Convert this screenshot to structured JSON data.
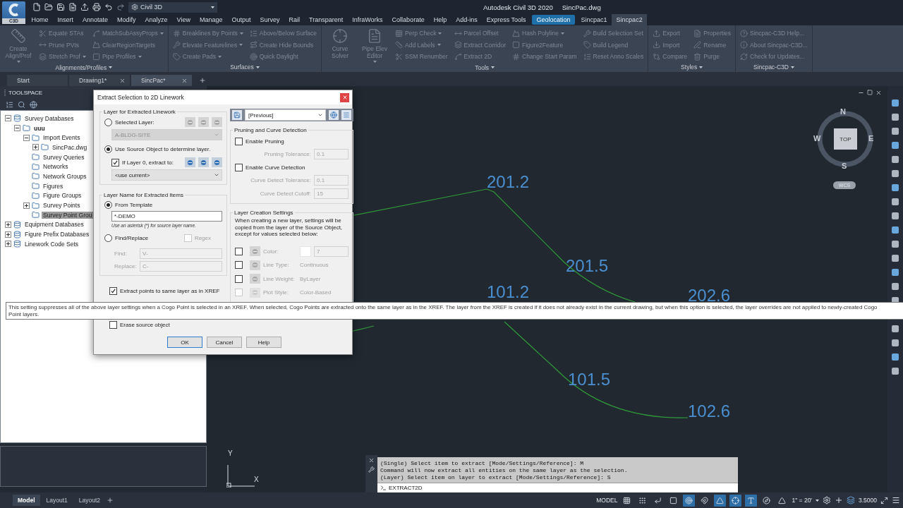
{
  "title_bar": {
    "app_badge": "C3D",
    "workspace": "Civil 3D",
    "title": "Autodesk Civil 3D 2020",
    "file": "SincPac.dwg"
  },
  "ribbon_tabs": [
    {
      "label": "Home",
      "kind": "normal",
      "selected": false
    },
    {
      "label": "Insert",
      "kind": "normal",
      "selected": false
    },
    {
      "label": "Annotate",
      "kind": "normal",
      "selected": false
    },
    {
      "label": "Modify",
      "kind": "normal",
      "selected": false
    },
    {
      "label": "Analyze",
      "kind": "normal",
      "selected": false
    },
    {
      "label": "View",
      "kind": "normal",
      "selected": false
    },
    {
      "label": "Manage",
      "kind": "normal",
      "selected": false
    },
    {
      "label": "Output",
      "kind": "normal",
      "selected": false
    },
    {
      "label": "Survey",
      "kind": "normal",
      "selected": false
    },
    {
      "label": "Rail",
      "kind": "normal",
      "selected": false
    },
    {
      "label": "Transparent",
      "kind": "normal",
      "selected": false
    },
    {
      "label": "InfraWorks",
      "kind": "normal",
      "selected": false
    },
    {
      "label": "Collaborate",
      "kind": "normal",
      "selected": false
    },
    {
      "label": "Help",
      "kind": "normal",
      "selected": false
    },
    {
      "label": "Add-ins",
      "kind": "normal",
      "selected": false
    },
    {
      "label": "Express Tools",
      "kind": "normal",
      "selected": false
    },
    {
      "label": "Geolocation",
      "kind": "contextual",
      "selected": false
    },
    {
      "label": "Sincpac1",
      "kind": "normal",
      "selected": false
    },
    {
      "label": "Sincpac2",
      "kind": "normal",
      "selected": true
    }
  ],
  "ribbon_panels": [
    {
      "title": "Alignments/Profiles",
      "columns": [
        [
          {
            "label": "Create Align/Prof",
            "kind": "large",
            "menu": true
          }
        ],
        [
          {
            "label": "Equate STAs",
            "kind": "small",
            "menu": false
          },
          {
            "label": "Prune PVIs",
            "kind": "small",
            "menu": false
          },
          {
            "label": "Stretch Prof",
            "kind": "small",
            "menu": true
          }
        ],
        [
          {
            "label": "MatchSubAssyProps",
            "kind": "small",
            "menu": true
          },
          {
            "label": "ClearRegionTargets",
            "kind": "small",
            "menu": false
          },
          {
            "label": "Pipe Profiles",
            "kind": "small",
            "menu": true
          }
        ]
      ]
    },
    {
      "title": "Surfaces",
      "columns": [
        [
          {
            "label": "Breaklines By Points",
            "kind": "small",
            "menu": true
          },
          {
            "label": "Elevate Featurelines",
            "kind": "small",
            "menu": true
          },
          {
            "label": "Create Pads",
            "kind": "small",
            "menu": true
          }
        ],
        [
          {
            "label": "Above/Below Surface",
            "kind": "small",
            "menu": false
          },
          {
            "label": "Create Hide Bounds",
            "kind": "small",
            "menu": false
          },
          {
            "label": "Quick Daylight",
            "kind": "small",
            "menu": false
          }
        ]
      ]
    },
    {
      "title": "Tools",
      "columns": [
        [
          {
            "label": "Curve Solver",
            "kind": "large",
            "menu": false
          }
        ],
        [
          {
            "label": "Pipe Elev Editor",
            "kind": "large",
            "menu": true
          }
        ],
        [
          {
            "label": "Perp Check",
            "kind": "small",
            "menu": true
          },
          {
            "label": "Add Labels",
            "kind": "small",
            "menu": true
          },
          {
            "label": "SSM Renumber",
            "kind": "small",
            "menu": false
          }
        ],
        [
          {
            "label": "Parcel Offset",
            "kind": "small",
            "menu": false
          },
          {
            "label": "Extract Corridor",
            "kind": "small",
            "menu": false
          },
          {
            "label": "Extract 2D",
            "kind": "small",
            "menu": false
          }
        ],
        [
          {
            "label": "Hash Polyline",
            "kind": "small",
            "menu": true
          },
          {
            "label": "Figure2Feature",
            "kind": "small",
            "menu": false
          },
          {
            "label": "Change Start Param",
            "kind": "small",
            "menu": false
          }
        ],
        [
          {
            "label": "Build Selection Set",
            "kind": "small",
            "menu": false
          },
          {
            "label": "Build Legend",
            "kind": "small",
            "menu": false
          },
          {
            "label": "Reset Anno Scales",
            "kind": "small",
            "menu": false
          }
        ]
      ]
    },
    {
      "title": "Styles",
      "columns": [
        [
          {
            "label": "Export",
            "kind": "small",
            "menu": false
          },
          {
            "label": "Import",
            "kind": "small",
            "menu": false
          },
          {
            "label": "Compare",
            "kind": "small",
            "menu": false
          }
        ],
        [
          {
            "label": "Properties",
            "kind": "small",
            "menu": false
          },
          {
            "label": "Rename",
            "kind": "small",
            "menu": false
          },
          {
            "label": "Purge",
            "kind": "small",
            "menu": false
          }
        ]
      ]
    },
    {
      "title": "Sincpac-C3D",
      "columns": [
        [
          {
            "label": "Sincpac-C3D Help...",
            "kind": "small",
            "menu": false
          },
          {
            "label": "About Sincpac-C3D...",
            "kind": "small",
            "menu": false
          },
          {
            "label": "Check for Updates...",
            "kind": "small",
            "menu": false
          }
        ]
      ]
    }
  ],
  "doc_tabs": [
    {
      "label": "Start",
      "closable": false,
      "selected": false
    },
    {
      "label": "Drawing1*",
      "closable": true,
      "selected": false
    },
    {
      "label": "SincPac*",
      "closable": true,
      "selected": true
    }
  ],
  "toolspace": {
    "title": "TOOLSPACE",
    "tree": [
      {
        "label": "Survey Databases",
        "expanded": true,
        "selected": false,
        "children": [
          {
            "label": "uuu",
            "expanded": true,
            "selected": false,
            "children": [
              {
                "label": "Import Events",
                "expanded": true,
                "selected": false,
                "children": [
                  {
                    "label": "SincPac.dwg",
                    "expanded": false,
                    "selected": false
                  }
                ]
              },
              {
                "label": "Survey Queries",
                "selected": false
              },
              {
                "label": "Networks",
                "selected": false
              },
              {
                "label": "Network Groups",
                "selected": false
              },
              {
                "label": "Figures",
                "selected": false
              },
              {
                "label": "Figure Groups",
                "selected": false
              },
              {
                "label": "Survey Points",
                "expanded": false,
                "selected": false
              },
              {
                "label": "Survey Point Grou",
                "selected": true
              }
            ]
          }
        ]
      },
      {
        "label": "Equipment Databases",
        "expanded": false,
        "selected": false
      },
      {
        "label": "Figure Prefix Databases",
        "expanded": false,
        "selected": false
      },
      {
        "label": "Linework Code Sets",
        "expanded": false,
        "selected": false
      }
    ]
  },
  "dialog": {
    "title": "Extract Selection to 2D Linework",
    "layer_group": {
      "title": "Layer for Extracted Linework",
      "options": [
        {
          "label": "Selected Layer:",
          "selected": false
        },
        {
          "label": "Use Source Object to determine layer.",
          "selected": true
        }
      ],
      "layer_dropdown": {
        "value": "A-BLDG-SITE",
        "disabled": true
      },
      "layer0_checkbox": {
        "label": "If Layer 0, extract to:",
        "checked": true
      },
      "layer0_dropdown": {
        "value": "<use current>"
      }
    },
    "name_group": {
      "title": "Layer Name for Extracted Items",
      "options": [
        {
          "label": "From Template",
          "selected": true
        },
        {
          "label": "Find/Replace",
          "selected": false
        }
      ],
      "template": {
        "value": "*-DEMO"
      },
      "hint": "Use an asterisk (*) for source layer name.",
      "regex": {
        "label": "Regex",
        "checked": false,
        "disabled": true
      },
      "find": {
        "label": "Find:",
        "value": "V-"
      },
      "replace": {
        "label": "Replace:",
        "value": "C-"
      }
    },
    "options": [
      {
        "label": "Extract points to same layer as in XREF",
        "checked": true
      },
      {
        "label": "Erase source object",
        "checked": false
      }
    ],
    "preset": {
      "value": "[Previous]"
    },
    "pruning_group": {
      "title": "Pruning and Curve Detection",
      "rows": [
        {
          "kind": "checkbox",
          "label": "Enable Pruning",
          "checked": false
        },
        {
          "kind": "field",
          "label": "Pruning Tolerance:",
          "value": "0.1"
        },
        {
          "kind": "checkbox",
          "label": "Enable Curve Detection",
          "checked": false
        },
        {
          "kind": "field",
          "label": "Curve Detect Tolerance:",
          "value": "0.1"
        },
        {
          "kind": "field",
          "label": "Curve Detect Cutoff:",
          "value": "15"
        }
      ]
    },
    "creation_group": {
      "title": "Layer Creation Settings",
      "description": "When creating a new layer, settings will be copied from the layer of the Source Object, except for values selected below:",
      "rows": [
        {
          "kind": "color",
          "label": "Color:",
          "value": "7",
          "checked": false,
          "disabled": false
        },
        {
          "kind": "text",
          "label": "Line Type:",
          "value": "Continuous",
          "checked": false,
          "disabled": false
        },
        {
          "kind": "text",
          "label": "Line Weight:",
          "value": "ByLayer",
          "checked": false,
          "disabled": false
        },
        {
          "kind": "text",
          "label": "Plot Style:",
          "value": "Color-Based",
          "checked": false,
          "disabled": true
        }
      ]
    },
    "buttons": [
      {
        "label": "OK",
        "default": true
      },
      {
        "label": "Cancel",
        "default": false
      },
      {
        "label": "Help",
        "default": false
      }
    ]
  },
  "tooltip": {
    "lines": [
      "This setting suppresses all of the above layer settings when a Cogo Point is selected in an XREF.  When selected, Cogo Points are extracted onto the same layer as in the XREF.  The layer from the XREF is created if it does not already exist in the current drawing, but when this option is selected, the layer overrides are not applied to newly-created Cogo",
      "Point layers."
    ]
  },
  "canvas_labels": [
    {
      "text": "201.2"
    },
    {
      "text": "201.5"
    },
    {
      "text": "101.2"
    },
    {
      "text": "202.6"
    },
    {
      "text": "101.5"
    },
    {
      "text": "102.6"
    }
  ],
  "viewcube": {
    "north": "N",
    "south": "S",
    "east": "E",
    "west": "W",
    "face": "TOP",
    "ucs": "WCS"
  },
  "ucs_icon": {
    "y": "Y",
    "x": "X"
  },
  "command_line": {
    "history": [
      "(Single) Select item to extract [Mode/Settings/Reference]: M",
      "Command will now extract all entities on the same layer as the selection.",
      "(Layer) Select item on layer to extract [Mode/Settings/Reference]: S"
    ],
    "input": "EXTRACT2D"
  },
  "status_bar": {
    "layout_tabs": [
      {
        "label": "Model",
        "selected": true
      },
      {
        "label": "Layout1",
        "selected": false
      },
      {
        "label": "Layout2",
        "selected": false
      }
    ],
    "space": "MODEL",
    "toggles": [
      {
        "on": false
      },
      {
        "on": false
      },
      {
        "on": false
      },
      {
        "on": false
      },
      {
        "on": true
      },
      {
        "on": false
      },
      {
        "on": true
      },
      {
        "on": true
      },
      {
        "on": true
      },
      {
        "on": false
      },
      {
        "on": false
      }
    ],
    "scale": "1\" = 20'",
    "elevation": "3.5000"
  }
}
